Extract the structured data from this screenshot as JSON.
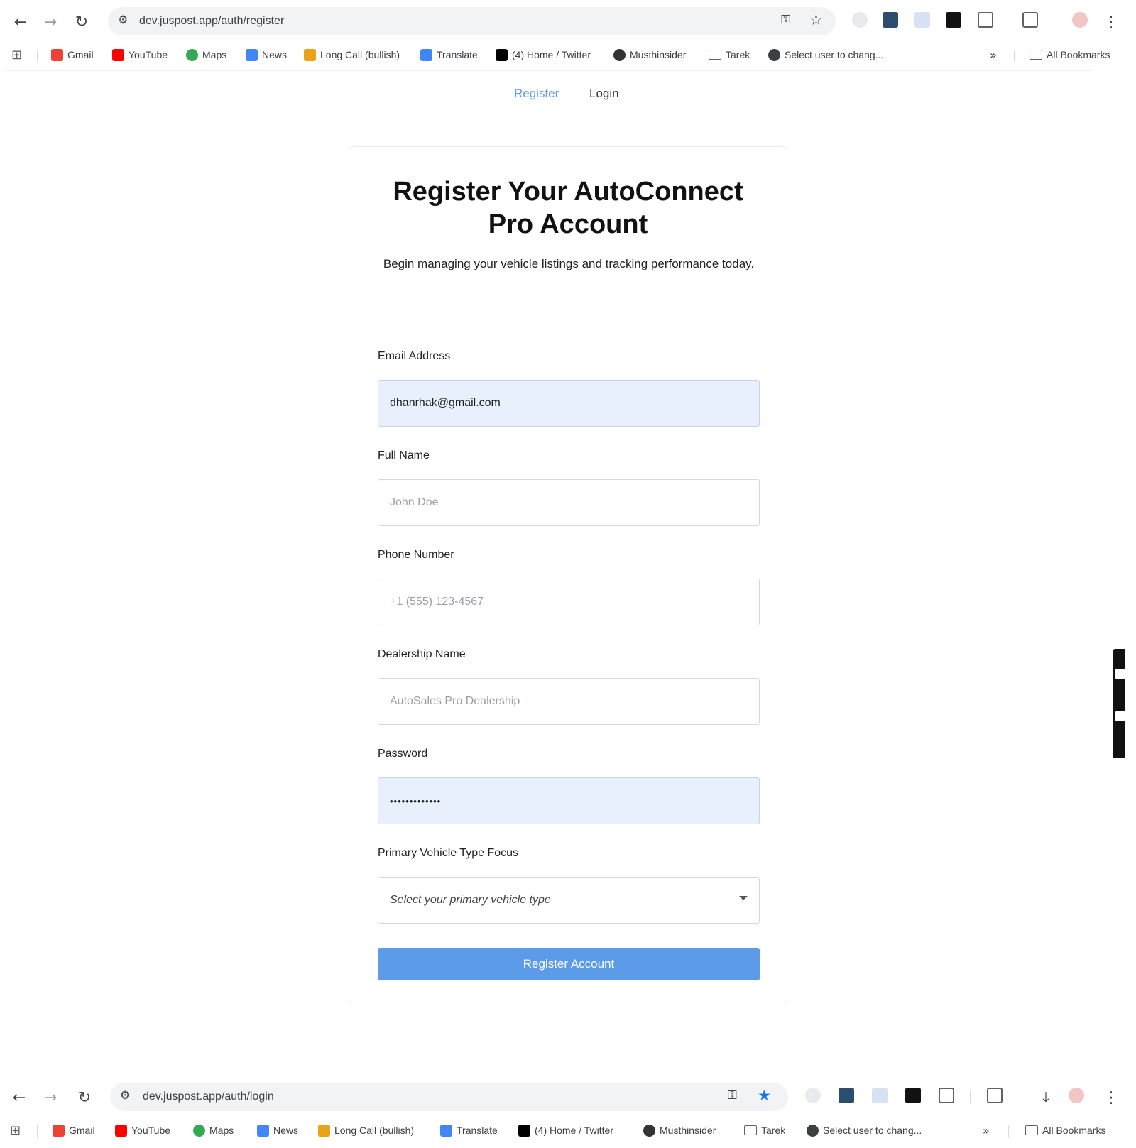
{
  "browser_top": {
    "url": "dev.juspost.app/auth/register",
    "star_filled": false
  },
  "browser_bottom": {
    "url": "dev.juspost.app/auth/login",
    "star_filled": true
  },
  "bookmarks": [
    {
      "label": "Gmail",
      "icon": "gmail-icon",
      "color": "#ea4335"
    },
    {
      "label": "YouTube",
      "icon": "youtube-icon",
      "color": "#ff0000"
    },
    {
      "label": "Maps",
      "icon": "maps-icon",
      "color": "#34a853"
    },
    {
      "label": "News",
      "icon": "news-icon",
      "color": "#4285f4"
    },
    {
      "label": "Long Call (bullish)",
      "icon": "chart-icon",
      "color": "#e8a317"
    },
    {
      "label": "Translate",
      "icon": "translate-icon",
      "color": "#4285f4"
    },
    {
      "label": "(4) Home / Twitter",
      "icon": "x-icon",
      "color": "#000000"
    },
    {
      "label": "Musthinsider",
      "icon": "musthinsider-icon",
      "color": "#333333"
    },
    {
      "label": "Tarek",
      "icon": "folder-icon",
      "color": "#5f6368"
    },
    {
      "label": "Select user to chang...",
      "icon": "globe-icon",
      "color": "#3c4043"
    }
  ],
  "all_bookmarks_label": "All Bookmarks",
  "auth_tabs": {
    "register": "Register",
    "login": "Login"
  },
  "form": {
    "title": "Register Your AutoConnect Pro Account",
    "subtitle": "Begin managing your vehicle listings and tracking performance today.",
    "email": {
      "label": "Email Address",
      "value": "dhanrhak@gmail.com"
    },
    "full_name": {
      "label": "Full Name",
      "placeholder": "John Doe"
    },
    "phone": {
      "label": "Phone Number",
      "placeholder": "+1 (555) 123-4567"
    },
    "dealership": {
      "label": "Dealership Name",
      "placeholder": "AutoSales Pro Dealership"
    },
    "password": {
      "label": "Password",
      "value": "•••••••••••••"
    },
    "vehicle_type": {
      "label": "Primary Vehicle Type Focus",
      "placeholder": "Select your primary vehicle type"
    },
    "submit_label": "Register Account"
  },
  "colors": {
    "accent": "#5b9be8",
    "autofill_bg": "#e8f0fe"
  }
}
